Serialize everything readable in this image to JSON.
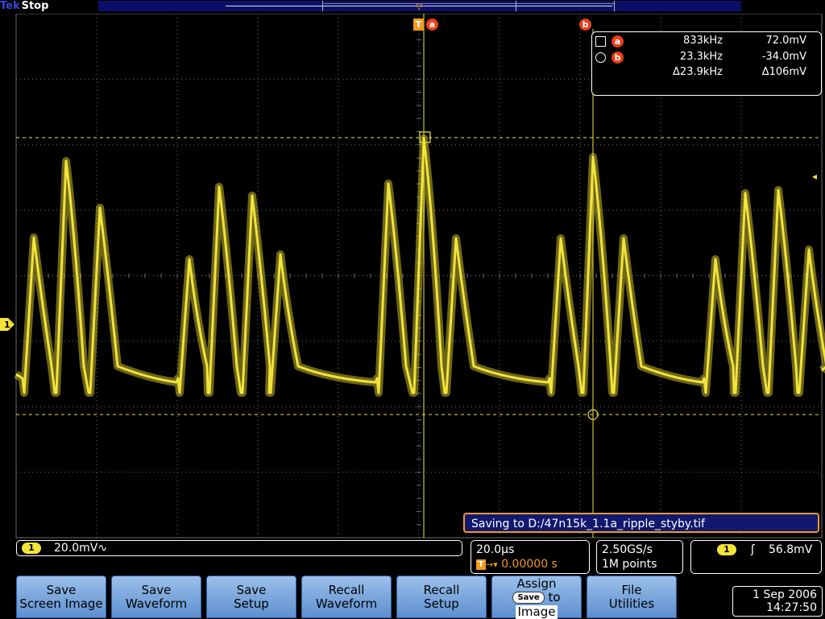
{
  "status_bar": {
    "brand": "Tek",
    "acq_state": "Stop"
  },
  "markers": {
    "trigger": "T",
    "cursor_a": "a",
    "cursor_b": "b"
  },
  "cursor_readout": {
    "row_a": {
      "cursor": "a",
      "freq": "833kHz",
      "volt": "72.0mV"
    },
    "row_b": {
      "cursor": "b",
      "freq": "23.3kHz",
      "volt": "-34.0mV"
    },
    "delta": {
      "freq": "Δ23.9kHz",
      "volt": "Δ106mV"
    }
  },
  "channel_marker": "1",
  "save_message": "Saving to D:/47n15k_1.1a_ripple_styby.tif",
  "channel_scale": {
    "channel": "1",
    "scale": "20.0mV∿"
  },
  "horizontal": {
    "time_div": "20.0µs",
    "trig_badge": "T",
    "position": "0.00000 s"
  },
  "acquisition": {
    "sample_rate": "2.50GS/s",
    "record_length": "1M points"
  },
  "trigger": {
    "channel": "1",
    "slope": "ʃ",
    "level": "56.8mV"
  },
  "menu": {
    "save_screen_image": [
      "Save",
      "Screen Image"
    ],
    "save_waveform": [
      "Save",
      "Waveform"
    ],
    "save_setup": [
      "Save",
      "Setup"
    ],
    "recall_waveform": [
      "Recall",
      "Waveform"
    ],
    "recall_setup": [
      "Recall",
      "Setup"
    ],
    "assign_save": {
      "line1": "Assign",
      "badge": "Save",
      "line2": "to",
      "line3": "Image"
    },
    "file_utilities": [
      "File",
      "Utilities"
    ]
  },
  "datetime": {
    "date": "1 Sep 2006",
    "time": "14:27:50"
  },
  "colors": {
    "trace": "#f2e33a",
    "accent": "#f39a1e",
    "marker": "#e8401c",
    "menu": "#7aa6dd"
  }
}
